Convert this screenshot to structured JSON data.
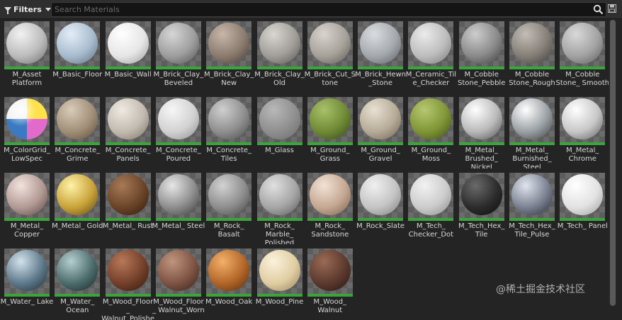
{
  "toolbar": {
    "filters_label": "Filters",
    "search_placeholder": "Search Materials",
    "search_value": ""
  },
  "materials": [
    {
      "label": "M_Asset Platform",
      "s": [
        "#f2f2f2",
        "#bcbcbc",
        "#6e6e6e"
      ]
    },
    {
      "label": "M_Basic_Floor",
      "s": [
        "#e4edf6",
        "#a8bccf",
        "#5c6f80"
      ]
    },
    {
      "label": "M_Basic_Wall",
      "s": [
        "#ffffff",
        "#e6e6e6",
        "#9a9a9a"
      ]
    },
    {
      "label": "M_Brick_Clay_Beveled",
      "s": [
        "#d6d6d6",
        "#9e9e9e",
        "#505050"
      ]
    },
    {
      "label": "M_Brick_Clay_New",
      "s": [
        "#c7b7aa",
        "#8c7c70",
        "#463a32"
      ]
    },
    {
      "label": "M_Brick_Clay_Old",
      "s": [
        "#d9d6d2",
        "#a19e9a",
        "#58554f"
      ]
    },
    {
      "label": "M_Brick_Cut_Stone",
      "s": [
        "#d8d4ce",
        "#a6a199",
        "#5b5750"
      ]
    },
    {
      "label": "M_Brick_Hewn_Stone",
      "s": [
        "#dadde0",
        "#a4a9ae",
        "#5a5f64"
      ]
    },
    {
      "label": "M_Ceramic_Tile_Checker",
      "s": [
        "#ebebeb",
        "#bdbdbd",
        "#777777"
      ]
    },
    {
      "label": "M_Cobble Stone_Pebble",
      "s": [
        "#cdcdcd",
        "#8a8a8a",
        "#3e3e3e"
      ]
    },
    {
      "label": "M_Cobble Stone_Rough",
      "s": [
        "#c2bdb6",
        "#857f78",
        "#403c37"
      ]
    },
    {
      "label": "M_Cobble Stone_ Smooth",
      "s": [
        "#d9d9d9",
        "#a3a3a3",
        "#5c5c5c"
      ]
    },
    {
      "label": "M_ColorGrid_ LowSpec",
      "s": [
        "#ffe14a",
        "#e26acb",
        "#3b7ac2"
      ]
    },
    {
      "label": "M_Concrete_ Grime",
      "s": [
        "#d8cbb8",
        "#a18f78",
        "#5a4a38"
      ]
    },
    {
      "label": "M_Concrete_ Panels",
      "s": [
        "#eee9e2",
        "#c3bbb0",
        "#7a7166"
      ]
    },
    {
      "label": "M_Concrete_ Poured",
      "s": [
        "#f6f6f6",
        "#d2d2d2",
        "#8c8c8c"
      ]
    },
    {
      "label": "M_Concrete_ Tiles",
      "s": [
        "#cfcfcf",
        "#8f8f8f",
        "#4a4a4a"
      ]
    },
    {
      "label": "M_Glass",
      "s": [
        "#b8b8b8",
        "#8f8f8f",
        "#6a6a6a"
      ]
    },
    {
      "label": "M_Ground_ Grass",
      "s": [
        "#a9c06a",
        "#6f8a35",
        "#344514"
      ]
    },
    {
      "label": "M_Ground_ Gravel",
      "s": [
        "#e8e0d2",
        "#b6ab98",
        "#6c624f"
      ]
    },
    {
      "label": "M_Ground_ Moss",
      "s": [
        "#b6c870",
        "#7f9536",
        "#3e4d12"
      ]
    },
    {
      "label": "M_Metal_ Brushed_ Nickel",
      "s": [
        "#ffffff",
        "#b9b9b9",
        "#4d4d4d"
      ]
    },
    {
      "label": "M_Metal_ Burnished_ Steel",
      "s": [
        "#ffffff",
        "#9aa0a4",
        "#3a3e41"
      ]
    },
    {
      "label": "M_Metal_ Chrome",
      "s": [
        "#ffffff",
        "#c7c7c7",
        "#5a5a5a"
      ]
    },
    {
      "label": "M_Metal_ Copper",
      "s": [
        "#f2e2de",
        "#b39a94",
        "#5a4540"
      ]
    },
    {
      "label": "M_Metal_ Gold",
      "s": [
        "#fff2a8",
        "#c9a33a",
        "#5e4510"
      ]
    },
    {
      "label": "M_Metal_ Rust",
      "s": [
        "#a77a58",
        "#6b4428",
        "#2c1a0d"
      ]
    },
    {
      "label": "M_Metal_ Steel",
      "s": [
        "#e6e6e6",
        "#8e8e8e",
        "#3a3a3a"
      ]
    },
    {
      "label": "M_Rock_ Basalt",
      "s": [
        "#d2d2d2",
        "#8e8e8e",
        "#444444"
      ]
    },
    {
      "label": "M_Rock_ Marble_ Polished",
      "s": [
        "#e0e0e0",
        "#a6a6a6",
        "#5a5a5a"
      ]
    },
    {
      "label": "M_Rock_ Sandstone",
      "s": [
        "#f2e2d5",
        "#c4a892",
        "#7a5e4a"
      ]
    },
    {
      "label": "M_Rock_Slate",
      "s": [
        "#f0f0f0",
        "#c4c4c4",
        "#7c7c7c"
      ]
    },
    {
      "label": "M_Tech_ Checker_Dot",
      "s": [
        "#f2f2f2",
        "#cccccc",
        "#8a8a8a"
      ]
    },
    {
      "label": "M_Tech_Hex_ Tile",
      "s": [
        "#6a6a6a",
        "#2c2c2c",
        "#0c0c0c"
      ]
    },
    {
      "label": "M_Tech_Hex_ Tile_Pulse",
      "s": [
        "#e0e4ee",
        "#7b8191",
        "#262a33"
      ]
    },
    {
      "label": "M_Tech_ Panel",
      "s": [
        "#ffffff",
        "#e2e2e2",
        "#9c9c9c"
      ]
    },
    {
      "label": "M_Water_ Lake",
      "s": [
        "#d3e2ec",
        "#5f7a8c",
        "#1c2a33"
      ]
    },
    {
      "label": "M_Water_ Ocean",
      "s": [
        "#b6cfcf",
        "#4d6d6d",
        "#152525"
      ]
    },
    {
      "label": "M_Wood_Floor_ Walnut_Polished",
      "s": [
        "#b8785a",
        "#74402a",
        "#2f170c"
      ]
    },
    {
      "label": "M_Wood_Floor_ Walnut_Worn",
      "s": [
        "#c0957e",
        "#7f5444",
        "#34201a"
      ]
    },
    {
      "label": "M_Wood_Oak",
      "s": [
        "#f4b06a",
        "#b36628",
        "#55290a"
      ]
    },
    {
      "label": "M_Wood_Pine",
      "s": [
        "#fbf2dc",
        "#e0cda2",
        "#98825a"
      ]
    },
    {
      "label": "M_Wood_ Walnut",
      "s": [
        "#9a6a56",
        "#5c3a2e",
        "#26150f"
      ]
    }
  ],
  "watermark": "@稀土掘金技术社区"
}
